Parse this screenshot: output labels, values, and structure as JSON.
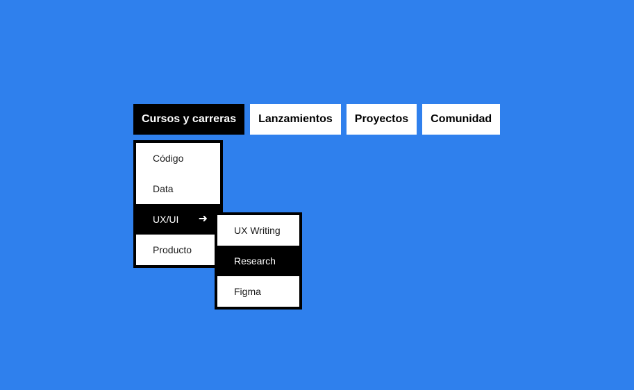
{
  "nav": {
    "items": [
      {
        "label": "Cursos y carreras",
        "active": true
      },
      {
        "label": "Lanzamientos",
        "active": false
      },
      {
        "label": "Proyectos",
        "active": false
      },
      {
        "label": "Comunidad",
        "active": false
      }
    ]
  },
  "menu": {
    "items": [
      {
        "label": "Código"
      },
      {
        "label": "Data"
      },
      {
        "label": "UX/UI",
        "active": true,
        "arrow": "➜",
        "arrow_icon": "arrow-right-icon"
      },
      {
        "label": "Producto"
      }
    ]
  },
  "submenu": {
    "items": [
      {
        "label": "UX Writing"
      },
      {
        "label": "Research",
        "active": true
      },
      {
        "label": "Figma"
      }
    ]
  },
  "colors": {
    "background": "#2f80ed",
    "active": "#000000",
    "inactive": "#ffffff"
  }
}
